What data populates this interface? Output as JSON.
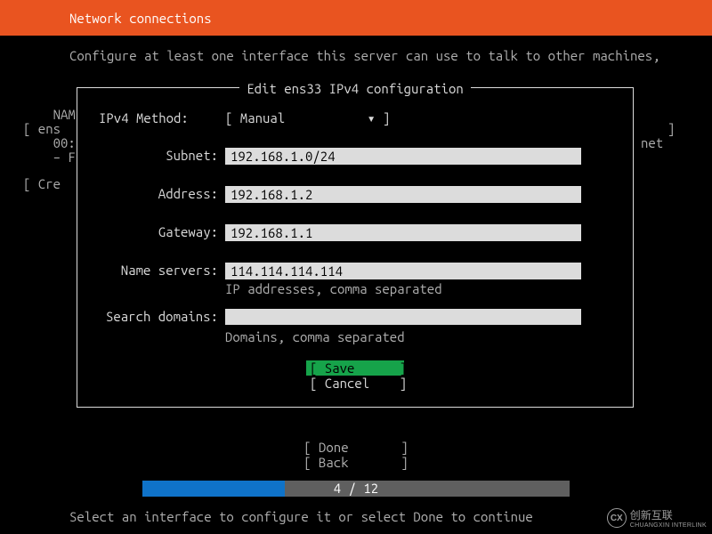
{
  "header": {
    "title": "Network connections"
  },
  "help": "Configure at least one interface this server can use to talk to other machines,",
  "background": {
    "line1_left": "    NAM",
    "line2_left": "[ ens",
    "line2_right": "]",
    "line3_left": "    00:",
    "line3_right": "net",
    "line4_left": "    – F",
    "line5_left": "[ Cre"
  },
  "dialog": {
    "title": " Edit ens33 IPv4 configuration ",
    "method_label": "IPv4 Method:",
    "method_value": "[ Manual           ▾ ]",
    "fields": {
      "subnet_label": "Subnet:",
      "subnet_value": "192.168.1.0/24",
      "address_label": "Address:",
      "address_value": "192.168.1.2",
      "gateway_label": "Gateway:",
      "gateway_value": "192.168.1.1",
      "nameservers_label": "Name servers:",
      "nameservers_value": "114.114.114.114",
      "nameservers_hint": "IP addresses, comma separated",
      "search_label": "Search domains:",
      "search_value": "",
      "search_hint": "Domains, comma separated"
    },
    "save_label": "[ Save      ]",
    "cancel_label": "[ Cancel    ]"
  },
  "bottom": {
    "done_label": "[ Done       ]",
    "back_label": "[ Back       ]"
  },
  "progress": {
    "current": 4,
    "total": 12,
    "label": "4 / 12"
  },
  "footer": "Select an interface to configure it or select Done to continue",
  "watermark": {
    "text": "创新互联",
    "sub": "CHUANGXIN INTERLINK"
  }
}
